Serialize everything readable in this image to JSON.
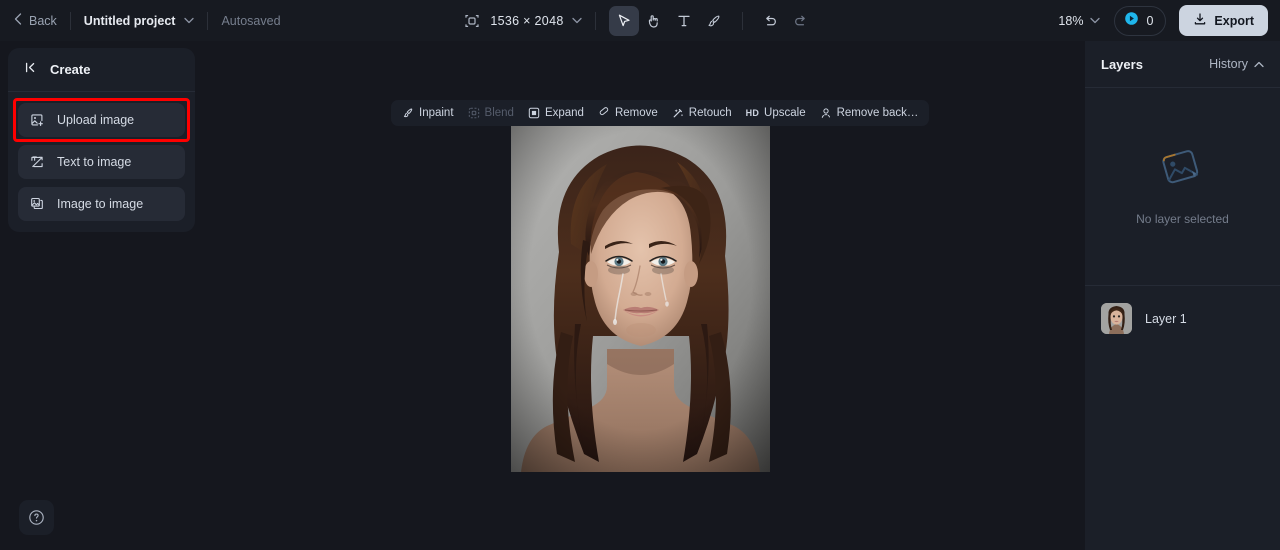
{
  "topbar": {
    "back_label": "Back",
    "project_name": "Untitled project",
    "autosaved_label": "Autosaved",
    "canvas_size": "1536 × 2048",
    "zoom_level": "18%",
    "credits_count": "0",
    "export_label": "Export",
    "tools": [
      {
        "name": "select-tool",
        "icon": "cursor-arrow-icon",
        "active": true
      },
      {
        "name": "hand-tool",
        "icon": "hand-icon",
        "active": false
      },
      {
        "name": "text-tool",
        "icon": "text-icon",
        "active": false
      },
      {
        "name": "brush-tool",
        "icon": "brush-icon",
        "active": false
      },
      {
        "name": "undo",
        "icon": "undo-icon",
        "active": false
      },
      {
        "name": "redo",
        "icon": "redo-icon",
        "active": false
      }
    ]
  },
  "left_panel": {
    "title": "Create",
    "items": [
      {
        "label": "Upload image",
        "icon": "image-plus-icon",
        "highlighted": true
      },
      {
        "label": "Text to image",
        "icon": "text-image-icon",
        "highlighted": false
      },
      {
        "label": "Image to image",
        "icon": "image-stack-icon",
        "highlighted": false
      }
    ]
  },
  "float_toolbar": {
    "items": [
      {
        "label": "Inpaint",
        "icon": "inpaint-brush-icon",
        "disabled": false
      },
      {
        "label": "Blend",
        "icon": "blend-icon",
        "disabled": true
      },
      {
        "label": "Expand",
        "icon": "expand-icon",
        "disabled": false
      },
      {
        "label": "Remove",
        "icon": "eraser-icon",
        "disabled": false
      },
      {
        "label": "Retouch",
        "icon": "magic-wand-icon",
        "disabled": false
      },
      {
        "label": "Upscale",
        "icon": "hd-icon",
        "disabled": false
      },
      {
        "label": "Remove back…",
        "icon": "remove-background-icon",
        "disabled": false
      }
    ]
  },
  "right_panel": {
    "title": "Layers",
    "history_label": "History",
    "empty_label": "No layer selected",
    "layers": [
      {
        "name": "Layer 1"
      }
    ]
  },
  "help": {
    "label": "?"
  },
  "colors": {
    "accent_red": "#ff0000",
    "credit_blue": "#29b6f6",
    "panel_bg": "#1b1f28",
    "canvas_bg": "#15171e",
    "topbar_bg": "#171a21"
  }
}
